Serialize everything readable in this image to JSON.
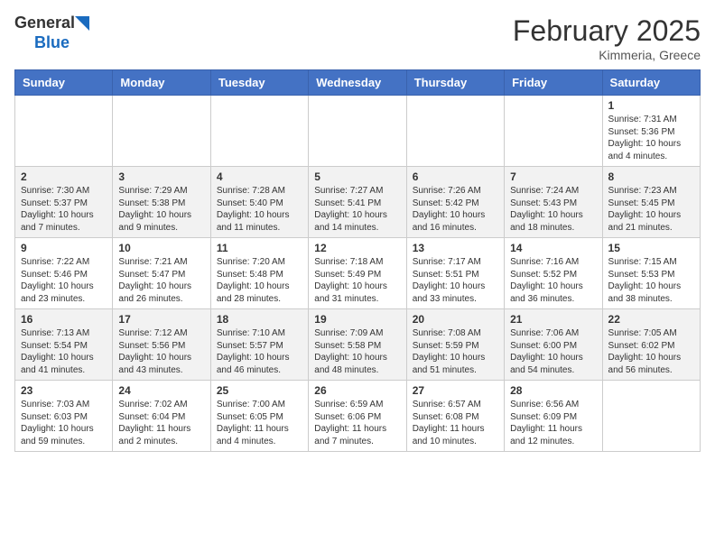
{
  "header": {
    "logo_general": "General",
    "logo_blue": "Blue",
    "month_year": "February 2025",
    "location": "Kimmeria, Greece"
  },
  "days_of_week": [
    "Sunday",
    "Monday",
    "Tuesday",
    "Wednesday",
    "Thursday",
    "Friday",
    "Saturday"
  ],
  "weeks": [
    [
      {
        "day": "",
        "info": ""
      },
      {
        "day": "",
        "info": ""
      },
      {
        "day": "",
        "info": ""
      },
      {
        "day": "",
        "info": ""
      },
      {
        "day": "",
        "info": ""
      },
      {
        "day": "",
        "info": ""
      },
      {
        "day": "1",
        "info": "Sunrise: 7:31 AM\nSunset: 5:36 PM\nDaylight: 10 hours and 4 minutes."
      }
    ],
    [
      {
        "day": "2",
        "info": "Sunrise: 7:30 AM\nSunset: 5:37 PM\nDaylight: 10 hours and 7 minutes."
      },
      {
        "day": "3",
        "info": "Sunrise: 7:29 AM\nSunset: 5:38 PM\nDaylight: 10 hours and 9 minutes."
      },
      {
        "day": "4",
        "info": "Sunrise: 7:28 AM\nSunset: 5:40 PM\nDaylight: 10 hours and 11 minutes."
      },
      {
        "day": "5",
        "info": "Sunrise: 7:27 AM\nSunset: 5:41 PM\nDaylight: 10 hours and 14 minutes."
      },
      {
        "day": "6",
        "info": "Sunrise: 7:26 AM\nSunset: 5:42 PM\nDaylight: 10 hours and 16 minutes."
      },
      {
        "day": "7",
        "info": "Sunrise: 7:24 AM\nSunset: 5:43 PM\nDaylight: 10 hours and 18 minutes."
      },
      {
        "day": "8",
        "info": "Sunrise: 7:23 AM\nSunset: 5:45 PM\nDaylight: 10 hours and 21 minutes."
      }
    ],
    [
      {
        "day": "9",
        "info": "Sunrise: 7:22 AM\nSunset: 5:46 PM\nDaylight: 10 hours and 23 minutes."
      },
      {
        "day": "10",
        "info": "Sunrise: 7:21 AM\nSunset: 5:47 PM\nDaylight: 10 hours and 26 minutes."
      },
      {
        "day": "11",
        "info": "Sunrise: 7:20 AM\nSunset: 5:48 PM\nDaylight: 10 hours and 28 minutes."
      },
      {
        "day": "12",
        "info": "Sunrise: 7:18 AM\nSunset: 5:49 PM\nDaylight: 10 hours and 31 minutes."
      },
      {
        "day": "13",
        "info": "Sunrise: 7:17 AM\nSunset: 5:51 PM\nDaylight: 10 hours and 33 minutes."
      },
      {
        "day": "14",
        "info": "Sunrise: 7:16 AM\nSunset: 5:52 PM\nDaylight: 10 hours and 36 minutes."
      },
      {
        "day": "15",
        "info": "Sunrise: 7:15 AM\nSunset: 5:53 PM\nDaylight: 10 hours and 38 minutes."
      }
    ],
    [
      {
        "day": "16",
        "info": "Sunrise: 7:13 AM\nSunset: 5:54 PM\nDaylight: 10 hours and 41 minutes."
      },
      {
        "day": "17",
        "info": "Sunrise: 7:12 AM\nSunset: 5:56 PM\nDaylight: 10 hours and 43 minutes."
      },
      {
        "day": "18",
        "info": "Sunrise: 7:10 AM\nSunset: 5:57 PM\nDaylight: 10 hours and 46 minutes."
      },
      {
        "day": "19",
        "info": "Sunrise: 7:09 AM\nSunset: 5:58 PM\nDaylight: 10 hours and 48 minutes."
      },
      {
        "day": "20",
        "info": "Sunrise: 7:08 AM\nSunset: 5:59 PM\nDaylight: 10 hours and 51 minutes."
      },
      {
        "day": "21",
        "info": "Sunrise: 7:06 AM\nSunset: 6:00 PM\nDaylight: 10 hours and 54 minutes."
      },
      {
        "day": "22",
        "info": "Sunrise: 7:05 AM\nSunset: 6:02 PM\nDaylight: 10 hours and 56 minutes."
      }
    ],
    [
      {
        "day": "23",
        "info": "Sunrise: 7:03 AM\nSunset: 6:03 PM\nDaylight: 10 hours and 59 minutes."
      },
      {
        "day": "24",
        "info": "Sunrise: 7:02 AM\nSunset: 6:04 PM\nDaylight: 11 hours and 2 minutes."
      },
      {
        "day": "25",
        "info": "Sunrise: 7:00 AM\nSunset: 6:05 PM\nDaylight: 11 hours and 4 minutes."
      },
      {
        "day": "26",
        "info": "Sunrise: 6:59 AM\nSunset: 6:06 PM\nDaylight: 11 hours and 7 minutes."
      },
      {
        "day": "27",
        "info": "Sunrise: 6:57 AM\nSunset: 6:08 PM\nDaylight: 11 hours and 10 minutes."
      },
      {
        "day": "28",
        "info": "Sunrise: 6:56 AM\nSunset: 6:09 PM\nDaylight: 11 hours and 12 minutes."
      },
      {
        "day": "",
        "info": ""
      }
    ]
  ]
}
